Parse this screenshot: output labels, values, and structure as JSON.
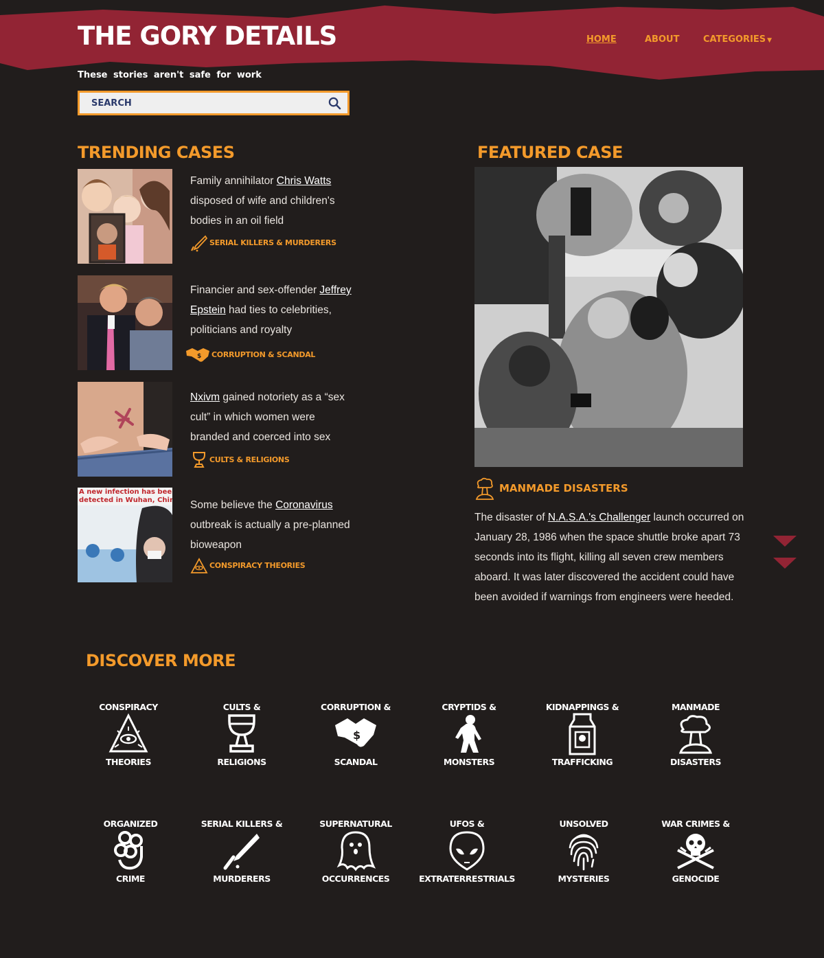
{
  "site": {
    "title": "THE GORY DETAILS",
    "tagline": "These stories aren't safe for work"
  },
  "nav": {
    "home": "HOME",
    "about": "ABOUT",
    "categories": "CATEGORIES"
  },
  "search": {
    "placeholder": "SEARCH"
  },
  "trending": {
    "title": "TRENDING CASES",
    "items": [
      {
        "pre": "Family annihilator ",
        "link": "Chris Watts",
        "post": " disposed of wife and children's bodies in an oil field",
        "category": "SERIAL KILLERS & MURDERERS",
        "icon": "knife-icon"
      },
      {
        "pre": "Financier and sex-offender ",
        "link": "Jeffrey Epstein",
        "post": " had ties to celebrities, politicians and royalty",
        "category": "CORRUPTION & SCANDAL",
        "icon": "handshake-icon"
      },
      {
        "pre": "",
        "link": "Nxivm",
        "post": " gained notoriety as a “sex cult” in which women were branded and coerced into sex",
        "category": "CULTS & RELIGIONS",
        "icon": "chalice-icon"
      },
      {
        "pre": "Some believe the ",
        "link": "Coronavirus",
        "post": " outbreak is actually a pre-planned bioweapon",
        "category": "CONSPIRACY THEORIES",
        "icon": "eye-pyramid-icon"
      }
    ]
  },
  "thumb_overlay": {
    "l1": "A new infection has been",
    "l2": "detected in Wuhan, China"
  },
  "featured": {
    "title": "FEATURED CASE",
    "category": "MANMADE DISASTERS",
    "pre": "The disaster of ",
    "link": "N.A.S.A.'s Challenger",
    "post": " launch occurred on January 28, 1986 when the space shuttle broke apart 73 seconds into its flight, killing all seven crew members aboard. It was later discovered the accident could have been avoided if warnings from engineers were heeded."
  },
  "discover": {
    "title": "DISCOVER MORE",
    "tiles": [
      {
        "top": "CONSPIRACY",
        "bottom": "THEORIES",
        "icon": "eye-pyramid-icon"
      },
      {
        "top": "CULTS &",
        "bottom": "RELIGIONS",
        "icon": "chalice-icon"
      },
      {
        "top": "CORRUPTION &",
        "bottom": "SCANDAL",
        "icon": "handshake-icon"
      },
      {
        "top": "CRYPTIDS &",
        "bottom": "MONSTERS",
        "icon": "bigfoot-icon"
      },
      {
        "top": "KIDNAPPINGS &",
        "bottom": "TRAFFICKING",
        "icon": "milk-carton-icon"
      },
      {
        "top": "MANMADE",
        "bottom": "DISASTERS",
        "icon": "mushroom-cloud-icon"
      },
      {
        "top": "ORGANIZED",
        "bottom": "CRIME",
        "icon": "brass-knuckles-icon"
      },
      {
        "top": "SERIAL KILLERS &",
        "bottom": "MURDERERS",
        "icon": "knife-icon"
      },
      {
        "top": "SUPERNATURAL",
        "bottom": "OCCURRENCES",
        "icon": "ghost-icon"
      },
      {
        "top": "UFOS &",
        "bottom": "EXTRATERRESTRIALS",
        "icon": "alien-icon"
      },
      {
        "top": "UNSOLVED",
        "bottom": "MYSTERIES",
        "icon": "fingerprint-icon"
      },
      {
        "top": "WAR CRIMES &",
        "bottom": "GENOCIDE",
        "icon": "skull-guns-icon"
      }
    ]
  },
  "colors": {
    "background": "#211d1c",
    "header": "#922434",
    "accent": "#f39a2b",
    "text": "#e9e4df"
  }
}
